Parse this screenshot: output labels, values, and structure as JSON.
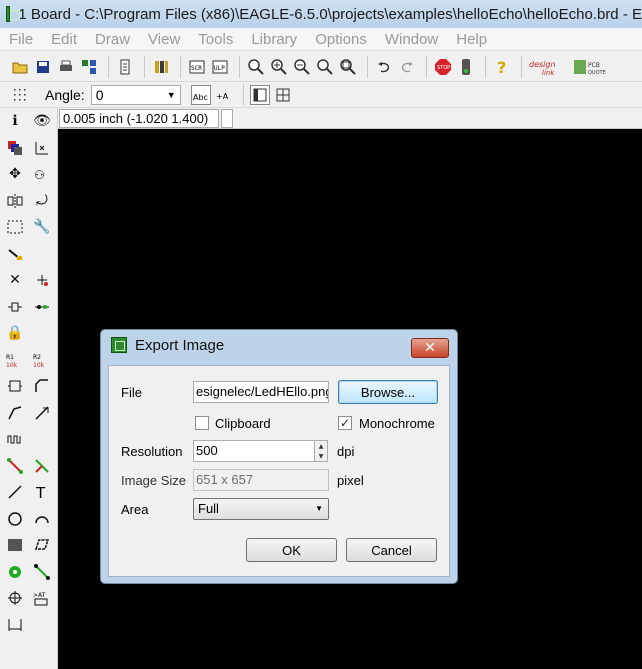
{
  "window": {
    "title": "1 Board - C:\\Program Files (x86)\\EAGLE-6.5.0\\projects\\examples\\helloEcho\\helloEcho.brd - E"
  },
  "menu": [
    "File",
    "Edit",
    "Draw",
    "View",
    "Tools",
    "Library",
    "Options",
    "Window",
    "Help"
  ],
  "toolbar": {
    "angle_label": "Angle:",
    "angle_value": "0"
  },
  "coordinates": {
    "readout": "0.005 inch (-1.020 1.400)"
  },
  "dialog": {
    "title": "Export Image",
    "close_glyph": "✕",
    "file_label": "File",
    "file_value": "esignelec/LedHEllo.png",
    "browse_label": "Browse...",
    "clipboard_label": "Clipboard",
    "clipboard_checked": false,
    "monochrome_label": "Monochrome",
    "monochrome_checked": true,
    "monochrome_mark": "✓",
    "resolution_label": "Resolution",
    "resolution_value": "500",
    "resolution_unit": "dpi",
    "image_size_label": "Image Size",
    "image_size_value": "651 x 657",
    "image_size_unit": "pixel",
    "area_label": "Area",
    "area_value": "Full",
    "ok_label": "OK",
    "cancel_label": "Cancel"
  },
  "colors": {
    "canvas": "#000000",
    "dialog_frame": "#bcd3ea"
  }
}
